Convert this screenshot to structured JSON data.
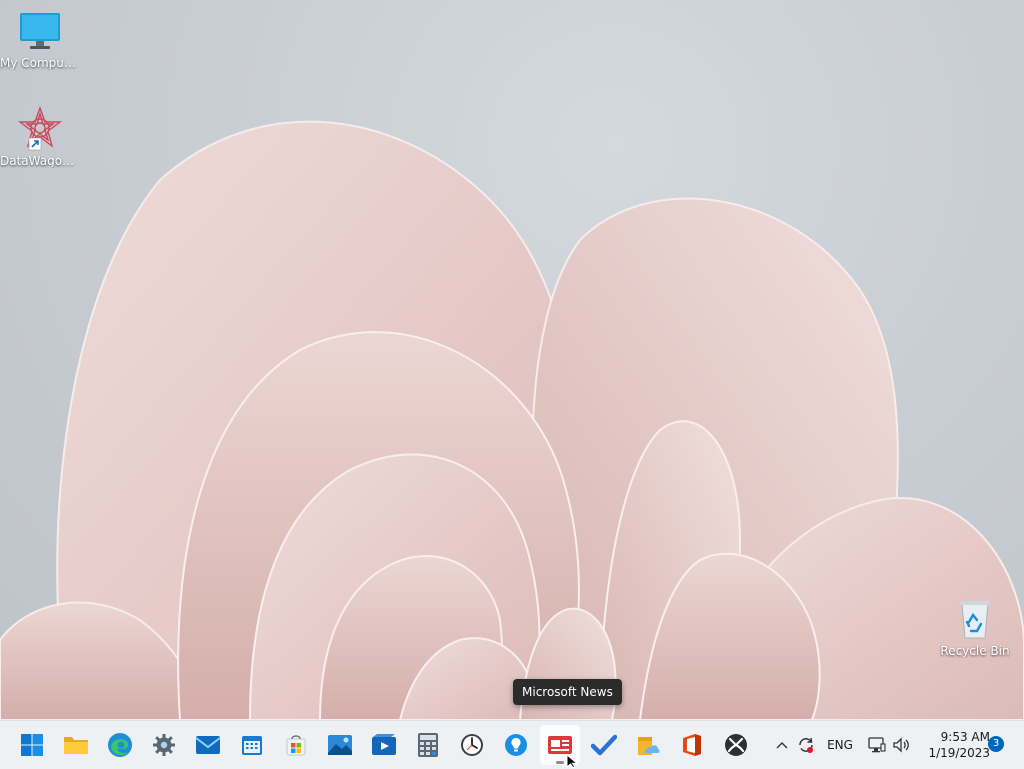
{
  "desktop": {
    "icons": [
      {
        "label": "My Computer",
        "icon": "monitor-icon"
      },
      {
        "label": "DataWagon...",
        "icon": "datawagon-shortcut-icon"
      },
      {
        "label": "Recycle Bin",
        "icon": "recycle-bin-icon"
      }
    ]
  },
  "tooltip": {
    "text": "Microsoft News"
  },
  "taskbar": {
    "apps": [
      {
        "name": "Start",
        "icon": "windows-start-icon"
      },
      {
        "name": "File Explorer",
        "icon": "folder-icon"
      },
      {
        "name": "Microsoft Edge",
        "icon": "edge-icon"
      },
      {
        "name": "Settings",
        "icon": "gear-icon"
      },
      {
        "name": "Mail",
        "icon": "mail-icon"
      },
      {
        "name": "Calendar",
        "icon": "calendar-icon"
      },
      {
        "name": "Microsoft Store",
        "icon": "store-icon"
      },
      {
        "name": "Photos",
        "icon": "photos-icon"
      },
      {
        "name": "Movies & TV",
        "icon": "video-icon"
      },
      {
        "name": "Calculator",
        "icon": "calculator-icon"
      },
      {
        "name": "Clock",
        "icon": "clock-icon"
      },
      {
        "name": "Tips",
        "icon": "lightbulb-icon"
      },
      {
        "name": "Microsoft News",
        "icon": "news-icon"
      },
      {
        "name": "To Do",
        "icon": "checkmark-icon"
      },
      {
        "name": "Weather",
        "icon": "weather-icon"
      },
      {
        "name": "Office",
        "icon": "office-icon"
      },
      {
        "name": "Xbox",
        "icon": "xbox-icon"
      }
    ],
    "tray": {
      "language": "ENG",
      "time": "9:53 AM",
      "date": "1/19/2023",
      "notification_count": "3"
    }
  },
  "colors": {
    "taskbar_bg": "#eef1f4",
    "tooltip_bg": "#2b2b2b",
    "accent": "#0067c0",
    "wallpaper_petal": "#e7cfcc"
  }
}
